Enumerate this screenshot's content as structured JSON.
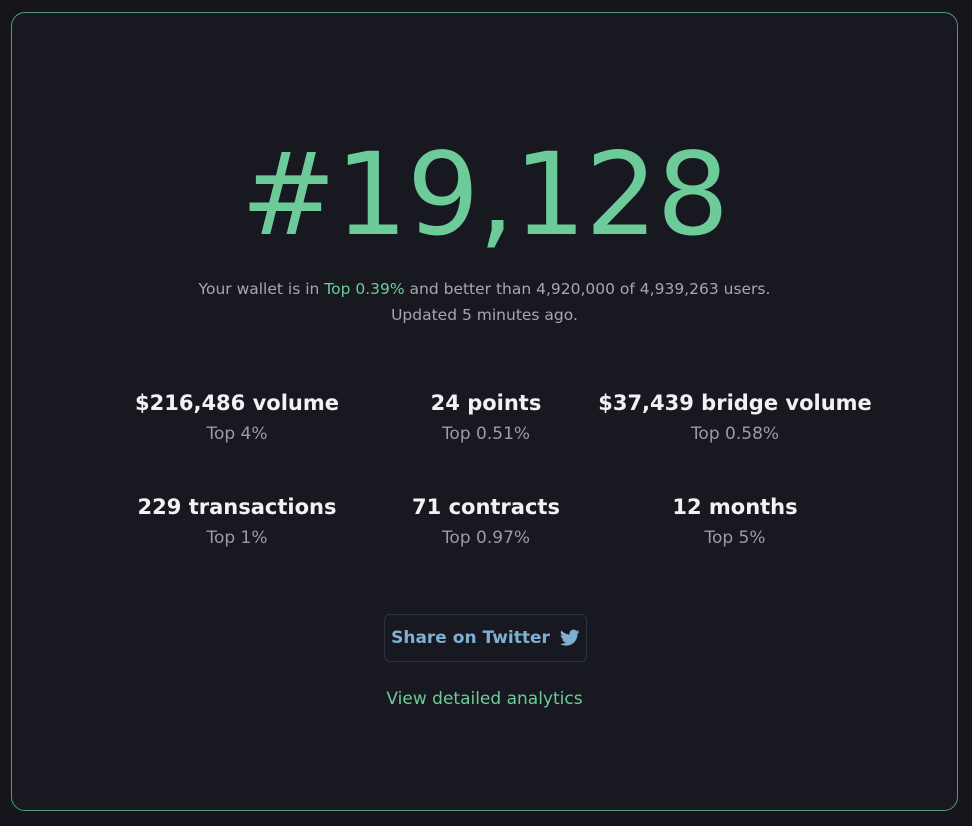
{
  "rank": {
    "value": "#19,128"
  },
  "summary": {
    "prefix": "Your wallet is in ",
    "highlight": "Top 0.39%",
    "suffix": " and better than 4,920,000 of 4,939,263 users.",
    "updated": "Updated 5 minutes ago."
  },
  "stats": [
    {
      "value": "$216,486 volume",
      "rank": "Top 4%"
    },
    {
      "value": "24 points",
      "rank": "Top 0.51%"
    },
    {
      "value": "$37,439 bridge volume",
      "rank": "Top 0.58%"
    },
    {
      "value": "229 transactions",
      "rank": "Top 1%"
    },
    {
      "value": "71 contracts",
      "rank": "Top 0.97%"
    },
    {
      "value": "12 months",
      "rank": "Top 5%"
    }
  ],
  "share": {
    "label": "Share on Twitter",
    "icon": "twitter-icon"
  },
  "analytics_link": "View detailed analytics",
  "colors": {
    "accent": "#6ccb99",
    "twitter": "#7fb0d2",
    "background": "#181820"
  }
}
